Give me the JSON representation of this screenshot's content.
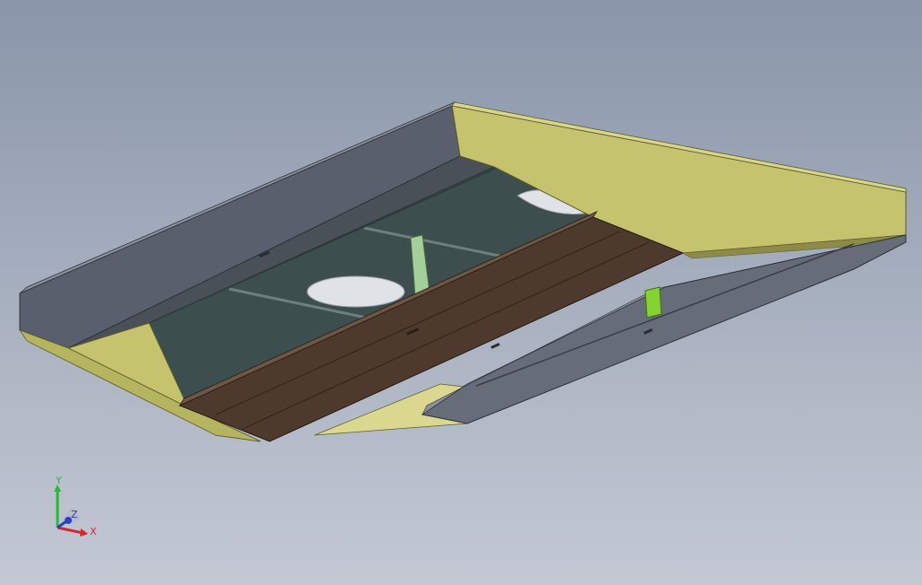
{
  "viewport": {
    "background_top": "#8995a9",
    "background_bottom": "#c3c8d3"
  },
  "model": {
    "colors": {
      "side_wall_dark": "#5a5f6d",
      "side_wall_top": "#6b7080",
      "floor_inner": "#3d4e4e",
      "end_panel_yellow": "#c5c36d",
      "inner_yellow": "#d9d88e",
      "brown_beam": "#4d3a2c",
      "brown_beam_edge": "#5e4838",
      "rail_gray": "#676c79",
      "green_strut": "#a3d099",
      "lime_block": "#84d22e",
      "hole": "#dfe2e7"
    }
  },
  "triad": {
    "axes": {
      "x_label": "X",
      "y_label": "Y",
      "z_label": "Z"
    },
    "colors": {
      "x": "#d8262a",
      "y": "#1fbf2b",
      "z": "#2b3fd0"
    }
  }
}
